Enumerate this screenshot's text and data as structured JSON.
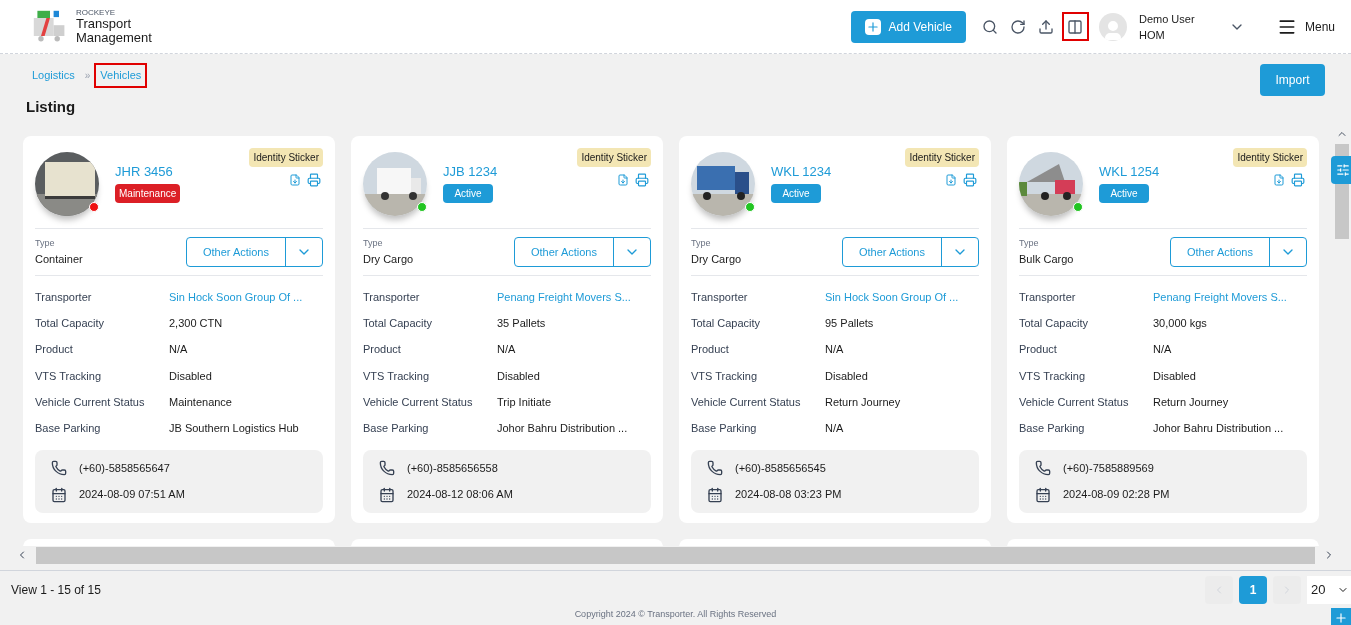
{
  "brand": {
    "small": "ROCKEYE",
    "line1": "Transport",
    "line2": "Management"
  },
  "header": {
    "add_button": "Add Vehicle",
    "user": {
      "name": "Demo User",
      "role": "HOM"
    },
    "menu": "Menu",
    "layout_highlighted": true
  },
  "breadcrumb": [
    {
      "label": "Logistics",
      "highlighted": false
    },
    {
      "separator": "»",
      "label": "Vehicles",
      "highlighted": true
    }
  ],
  "title": "Listing",
  "import_button": "Import",
  "vehicles": [
    {
      "plate": "JHR 3456",
      "status": {
        "label": "Maintenance",
        "kind": "maintenance"
      },
      "online": false,
      "sticker": "Identity Sticker",
      "type_label": "Type",
      "type": "Container",
      "actions": "Other Actions",
      "details": [
        {
          "label": "Transporter",
          "value": "Sin Hock Soon Group Of ...",
          "kind": "link"
        },
        {
          "label": "Total Capacity",
          "value": "2,300 CTN",
          "kind": "text"
        },
        {
          "label": "Product",
          "value": "N/A",
          "kind": "text"
        },
        {
          "label": "VTS Tracking",
          "value": "Disabled",
          "kind": "text"
        },
        {
          "label": "Vehicle Current Status",
          "value": "Maintenance",
          "kind": "text"
        },
        {
          "label": "Base Parking",
          "value": "JB Southern Logistics Hub",
          "kind": "text"
        }
      ],
      "phone": "(+60)-5858565647",
      "date": "2024-08-09 07:51 AM"
    },
    {
      "plate": "JJB 1234",
      "status": {
        "label": "Active",
        "kind": "active"
      },
      "online": true,
      "sticker": "Identity Sticker",
      "type_label": "Type",
      "type": "Dry Cargo",
      "actions": "Other Actions",
      "details": [
        {
          "label": "Transporter",
          "value": "Penang Freight Movers S...",
          "kind": "link"
        },
        {
          "label": "Total Capacity",
          "value": "35 Pallets",
          "kind": "text"
        },
        {
          "label": "Product",
          "value": "N/A",
          "kind": "text"
        },
        {
          "label": "VTS Tracking",
          "value": "Disabled",
          "kind": "text"
        },
        {
          "label": "Vehicle Current Status",
          "value": "Trip Initiate",
          "kind": "text"
        },
        {
          "label": "Base Parking",
          "value": "Johor Bahru Distribution ...",
          "kind": "text"
        }
      ],
      "phone": "(+60)-8585656558",
      "date": "2024-08-12 08:06 AM"
    },
    {
      "plate": "WKL 1234",
      "status": {
        "label": "Active",
        "kind": "active"
      },
      "online": true,
      "sticker": "Identity Sticker",
      "type_label": "Type",
      "type": "Dry Cargo",
      "actions": "Other Actions",
      "details": [
        {
          "label": "Transporter",
          "value": "Sin Hock Soon Group Of ...",
          "kind": "link"
        },
        {
          "label": "Total Capacity",
          "value": "95 Pallets",
          "kind": "text"
        },
        {
          "label": "Product",
          "value": "N/A",
          "kind": "text"
        },
        {
          "label": "VTS Tracking",
          "value": "Disabled",
          "kind": "text"
        },
        {
          "label": "Vehicle Current Status",
          "value": "Return Journey",
          "kind": "text"
        },
        {
          "label": "Base Parking",
          "value": "N/A",
          "kind": "text"
        }
      ],
      "phone": "(+60)-8585656545",
      "date": "2024-08-08 03:23 PM"
    },
    {
      "plate": "WKL 1254",
      "status": {
        "label": "Active",
        "kind": "active"
      },
      "online": true,
      "sticker": "Identity Sticker",
      "type_label": "Type",
      "type": "Bulk Cargo",
      "actions": "Other Actions",
      "details": [
        {
          "label": "Transporter",
          "value": "Penang Freight Movers S...",
          "kind": "link"
        },
        {
          "label": "Total Capacity",
          "value": "30,000 kgs",
          "kind": "text"
        },
        {
          "label": "Product",
          "value": "N/A",
          "kind": "text"
        },
        {
          "label": "VTS Tracking",
          "value": "Disabled",
          "kind": "text"
        },
        {
          "label": "Vehicle Current Status",
          "value": "Return Journey",
          "kind": "text"
        },
        {
          "label": "Base Parking",
          "value": "Johor Bahru Distribution ...",
          "kind": "text"
        }
      ],
      "phone": "(+60)-7585889569",
      "date": "2024-08-09 02:28 PM"
    }
  ],
  "footer": {
    "view": "View 1 - 15 of 15",
    "pages": [
      {
        "label": "1",
        "selected": true
      }
    ],
    "prev_disabled": true,
    "next_disabled": true,
    "page_size": "20",
    "copyright": "Copyright 2024 © Transporter. All Rights Reserved"
  }
}
